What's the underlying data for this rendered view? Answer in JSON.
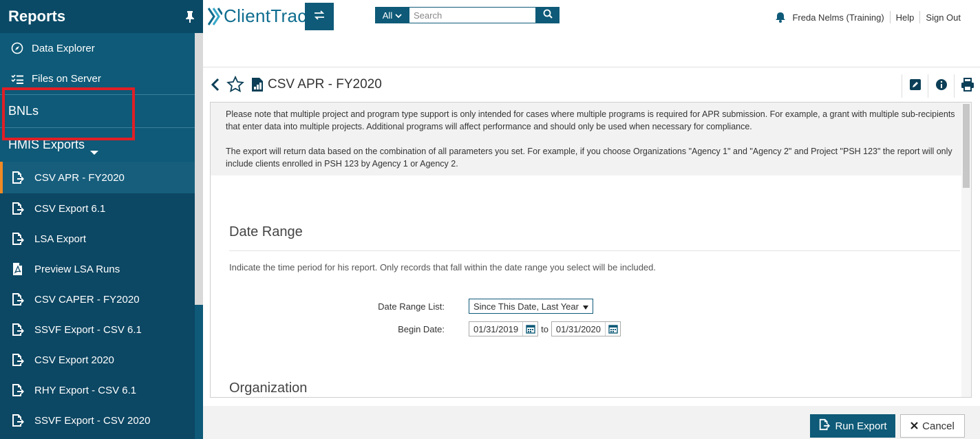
{
  "sidebar": {
    "title": "Reports",
    "top_items": [
      {
        "label": "Data Explorer",
        "icon": "compass-icon"
      },
      {
        "label": "Files on Server",
        "icon": "checklist-icon"
      }
    ],
    "section_bnls": "BNLs",
    "section_hmis": "HMIS Exports",
    "sub_items": [
      {
        "label": "CSV APR - FY2020",
        "icon": "file-export-icon",
        "active": true
      },
      {
        "label": "CSV Export 6.1",
        "icon": "file-export-icon"
      },
      {
        "label": "LSA Export",
        "icon": "file-export-icon"
      },
      {
        "label": "Preview LSA Runs",
        "icon": "pdf-file-icon"
      },
      {
        "label": "CSV CAPER - FY2020",
        "icon": "file-export-icon"
      },
      {
        "label": "SSVF Export - CSV 6.1",
        "icon": "file-export-icon"
      },
      {
        "label": "CSV Export 2020",
        "icon": "file-export-icon"
      },
      {
        "label": "RHY Export - CSV 6.1",
        "icon": "file-export-icon"
      },
      {
        "label": "SSVF Export - CSV 2020",
        "icon": "file-export-icon"
      }
    ]
  },
  "topbar": {
    "logo_text": "ClientTrack",
    "scope": "All",
    "search_placeholder": "Search",
    "user": "Freda Nelms (Training)",
    "help": "Help",
    "signout": "Sign Out"
  },
  "page": {
    "title": "CSV APR - FY2020",
    "notice_1": "Please note that multiple project and program type support is only intended for cases where multiple programs is required for APR submission. For example, a grant with multiple sub-recipients that enter data into multiple projects. Additional programs will affect performance and should only be used when necessary for compliance.",
    "notice_2": "The export will return data based on the combination of all parameters you set. For example, if you choose Organizations \"Agency 1\" and \"Agency 2\" and Project \"PSH 123\" the report will only include clients enrolled in PSH 123 by Agency 1 or Agency 2.",
    "date_range_heading": "Date Range",
    "date_range_desc": "Indicate the time period for his report. Only records that fall within the date range you select will be included.",
    "date_range_list_label": "Date Range List:",
    "date_range_list_value": "Since This Date, Last Year",
    "begin_date_label": "Begin Date:",
    "begin_date": "01/31/2019",
    "to_label": "to",
    "end_date": "01/31/2020",
    "organization_heading": "Organization"
  },
  "footer": {
    "run_label": "Run Export",
    "cancel_label": "Cancel"
  },
  "colors": {
    "sidebar": "#0e5a78",
    "accent": "#f08a24",
    "highlight": "#e01f26"
  }
}
